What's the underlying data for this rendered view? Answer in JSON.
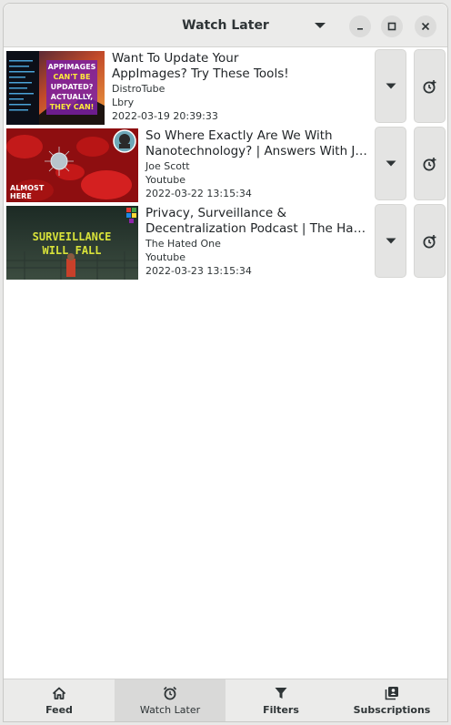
{
  "window": {
    "title": "Watch Later"
  },
  "videos": [
    {
      "title_line1": "Want To Update Your",
      "title_line2": "AppImages? Try These Tools!",
      "channel": "DistroTube",
      "platform": "Lbry",
      "date": "2022-03-19 20:39:33",
      "thumb_text": [
        "APPIMAGES",
        "CAN'T BE",
        "UPDATED?",
        "ACTUALLY,",
        "THEY CAN!"
      ]
    },
    {
      "title_line1": "So Where Exactly Are We With",
      "title_line2": "Nanotechnology? | Answers With Joe",
      "channel": "Joe Scott",
      "platform": "Youtube",
      "date": "2022-03-22 13:15:34",
      "thumb_text": [
        "ALMOST",
        "HERE"
      ]
    },
    {
      "title_line1": "Privacy, Surveillance &",
      "title_line2": "Decentralization Podcast | The Hated One",
      "channel": "The Hated One",
      "platform": "Youtube",
      "date": "2022-03-23 13:15:34",
      "thumb_text": [
        "SURVEILLANCE",
        "WILL FALL"
      ]
    }
  ],
  "nav": [
    {
      "label": "Feed",
      "icon": "home-icon"
    },
    {
      "label": "Watch Later",
      "icon": "alarm-clock-icon",
      "active": true
    },
    {
      "label": "Filters",
      "icon": "filter-icon"
    },
    {
      "label": "Subscriptions",
      "icon": "subscriptions-icon"
    }
  ]
}
